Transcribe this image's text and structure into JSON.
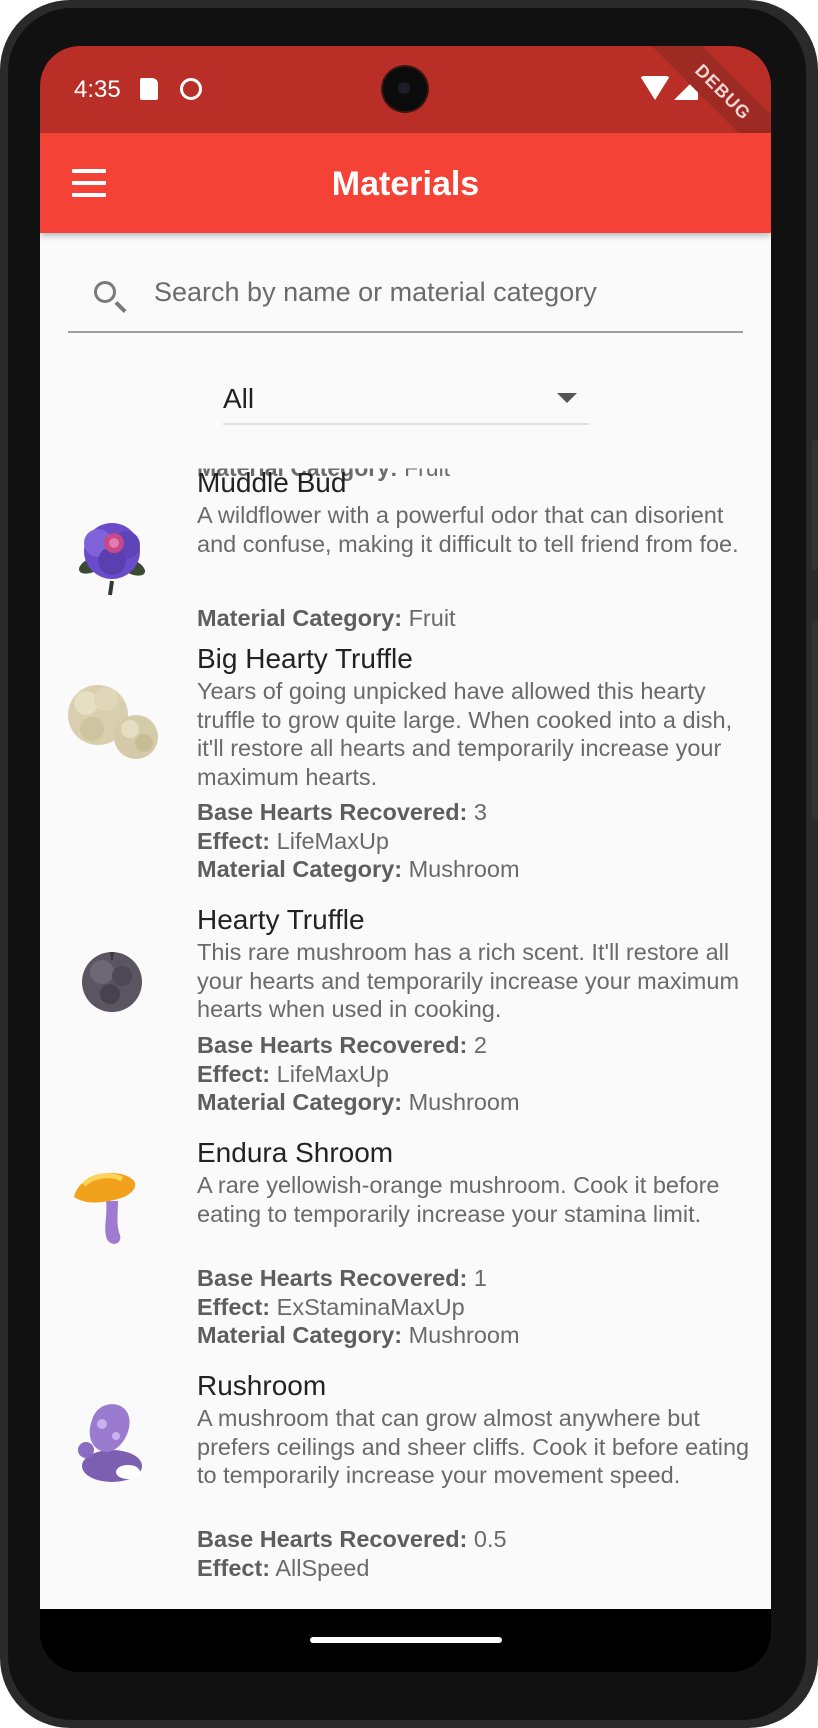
{
  "status_bar": {
    "time": "4:35",
    "debug_label": "DEBUG"
  },
  "app_bar": {
    "title": "Materials"
  },
  "search": {
    "placeholder": "Search by name or material category",
    "value": ""
  },
  "filter": {
    "selected": "All"
  },
  "partial_top_item": {
    "label": "Material Category:",
    "value": "Fruit"
  },
  "materials": [
    {
      "name": "Muddle Bud",
      "description": "A wildflower with a powerful odor that can disorient and confuse, making it difficult to tell friend from foe.",
      "attributes": [
        {
          "label": "Material Category:",
          "value": "Fruit"
        }
      ]
    },
    {
      "name": "Big Hearty Truffle",
      "description": "Years of going unpicked have allowed this hearty truffle to grow quite large. When cooked into a dish, it'll restore all hearts and temporarily increase your maximum hearts.",
      "attributes": [
        {
          "label": "Base Hearts Recovered:",
          "value": "3"
        },
        {
          "label": "Effect:",
          "value": "LifeMaxUp"
        },
        {
          "label": "Material Category:",
          "value": "Mushroom"
        }
      ]
    },
    {
      "name": "Hearty Truffle",
      "description": "This rare mushroom has a rich scent. It'll restore all your hearts and temporarily increase your maximum hearts when used in cooking.",
      "attributes": [
        {
          "label": "Base Hearts Recovered:",
          "value": "2"
        },
        {
          "label": "Effect:",
          "value": "LifeMaxUp"
        },
        {
          "label": "Material Category:",
          "value": "Mushroom"
        }
      ]
    },
    {
      "name": "Endura Shroom",
      "description": "A rare yellowish-orange mushroom. Cook it before eating to temporarily increase your stamina limit.",
      "attributes": [
        {
          "label": "Base Hearts Recovered:",
          "value": "1"
        },
        {
          "label": "Effect:",
          "value": "ExStaminaMaxUp"
        },
        {
          "label": "Material Category:",
          "value": "Mushroom"
        }
      ]
    },
    {
      "name": "Rushroom",
      "description": "A mushroom that can grow almost anywhere but prefers ceilings and sheer cliffs. Cook it before eating to temporarily increase your movement speed.",
      "attributes": [
        {
          "label": "Base Hearts Recovered:",
          "value": "0.5"
        },
        {
          "label": "Effect:",
          "value": "AllSpeed"
        }
      ]
    }
  ]
}
